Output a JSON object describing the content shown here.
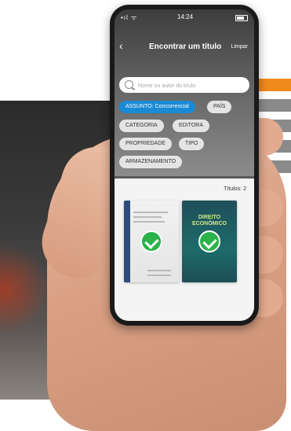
{
  "status_bar": {
    "time": "14:24"
  },
  "nav": {
    "back_icon": "chevron-left-icon",
    "title": "Encontrar um título",
    "clear_label": "Limpar"
  },
  "search": {
    "placeholder": "Nome ou autor do título",
    "icon": "search-icon"
  },
  "filters": [
    {
      "label": "ASSUNTO: Concorrencial",
      "active": true
    },
    {
      "label": "PAÍS",
      "active": false
    },
    {
      "label": "CATEGORIA",
      "active": false
    },
    {
      "label": "EDITORA",
      "active": false
    },
    {
      "label": "PROPRIEDADE",
      "active": false
    },
    {
      "label": "TIPO",
      "active": false
    },
    {
      "label": "ARMAZENAMENTO",
      "active": false
    }
  ],
  "results": {
    "count_label": "Títulos:",
    "count_value": "2"
  },
  "books": [
    {
      "cover_title": "",
      "selected": true
    },
    {
      "cover_title": "DIREITO ECONÔMICO",
      "selected": true
    }
  ],
  "colors": {
    "accent": "#1a8ad4",
    "check": "#2bb34a",
    "brand_orange": "#f08a1c"
  }
}
